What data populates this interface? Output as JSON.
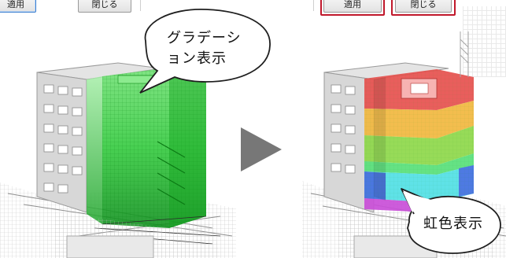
{
  "left_panel": {
    "apply_label": "適用",
    "close_label": "閉じる"
  },
  "right_panel": {
    "apply_label": "適用",
    "close_label": "閉じる"
  },
  "callouts": {
    "gradation_line1": "グラデーシ",
    "gradation_line2": "ョン表示",
    "rainbow": "虹色表示"
  },
  "colors": {
    "highlight": "#c0182b",
    "arrow": "#767676",
    "gradation": "#23c62d",
    "rainbow_bands": [
      "#e8514f",
      "#f2b840",
      "#8fd84a",
      "#59e07a",
      "#52e0e6",
      "#3f6fe0",
      "#c94fd8"
    ]
  }
}
